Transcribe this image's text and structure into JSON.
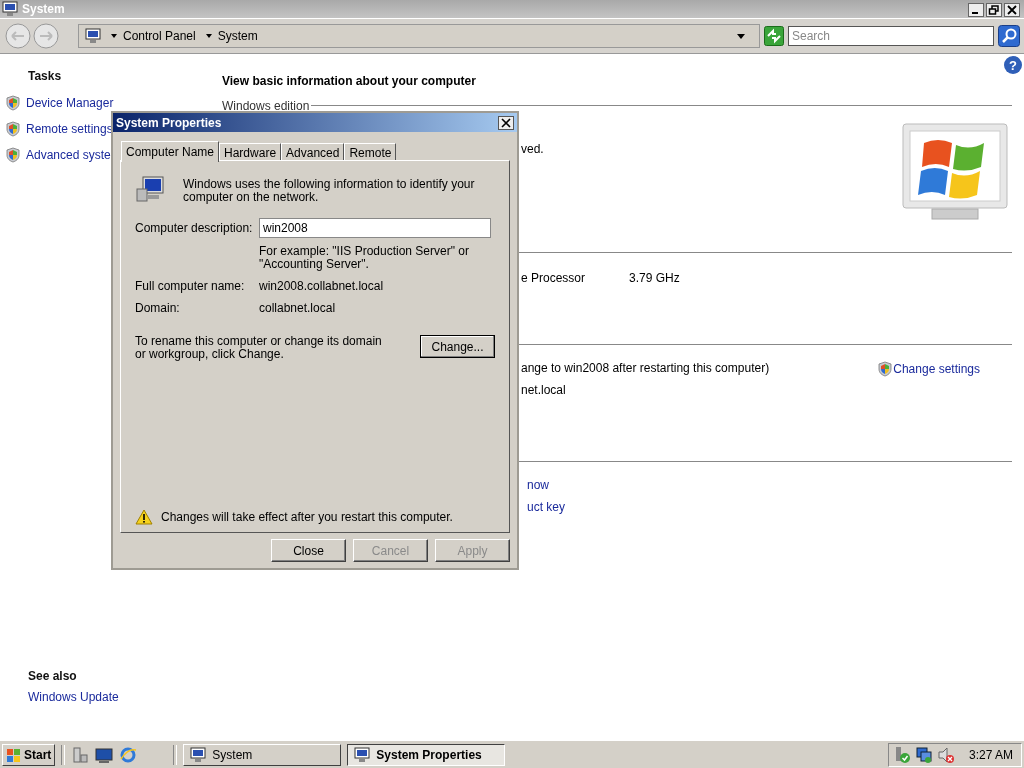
{
  "window": {
    "title": "System"
  },
  "address_bar": {
    "breadcrumbs": [
      "Control Panel",
      "System"
    ]
  },
  "search": {
    "placeholder": "Search"
  },
  "help": "?",
  "sidebar": {
    "tasks_heading": "Tasks",
    "tasks": [
      "Device Manager",
      "Remote settings",
      "Advanced syste"
    ],
    "see_also_heading": "See also",
    "see_also": [
      "Windows Update"
    ]
  },
  "main": {
    "heading": "View basic information about your computer",
    "sections": [
      {
        "title": "Windows edition",
        "rows": [
          {
            "kind": "text",
            "text": "ved."
          }
        ]
      },
      {
        "rows": [
          {
            "kind": "pair",
            "text": "e Processor",
            "value": "3.79 GHz"
          }
        ]
      },
      {
        "rows": [
          {
            "kind": "text",
            "text": "ange to win2008 after restarting this computer)"
          },
          {
            "kind": "text",
            "text": "net.local"
          }
        ],
        "action": "Change settings"
      },
      {
        "rows": [
          {
            "kind": "link",
            "text": "now"
          },
          {
            "kind": "link",
            "text": "uct key"
          }
        ]
      }
    ]
  },
  "dialog": {
    "title": "System Properties",
    "tabs": [
      {
        "label": "Computer Name",
        "selected": true
      },
      {
        "label": "Hardware",
        "selected": false
      },
      {
        "label": "Advanced",
        "selected": false
      },
      {
        "label": "Remote",
        "selected": false
      }
    ],
    "intro": "Windows uses the following information to identify your computer on the network.",
    "description": {
      "label": "Computer description:",
      "value": "win2008",
      "hint": "For example: \"IIS Production Server\" or \"Accounting Server\"."
    },
    "fields": [
      {
        "label": "Full computer name:",
        "value": "win2008.collabnet.local"
      },
      {
        "label": "Domain:",
        "value": "collabnet.local"
      }
    ],
    "rename_text": "To rename this computer or change its domain or workgroup, click Change.",
    "change_button": "Change...",
    "warning": "Changes will take effect after you restart this computer.",
    "buttons": [
      {
        "label": "Close",
        "disabled": false
      },
      {
        "label": "Cancel",
        "disabled": true
      },
      {
        "label": "Apply",
        "disabled": true
      }
    ]
  },
  "taskbar": {
    "start": "Start",
    "tasks": [
      {
        "label": "System",
        "selected": false
      },
      {
        "label": "System Properties",
        "selected": true
      }
    ],
    "clock": "3:27 AM"
  }
}
